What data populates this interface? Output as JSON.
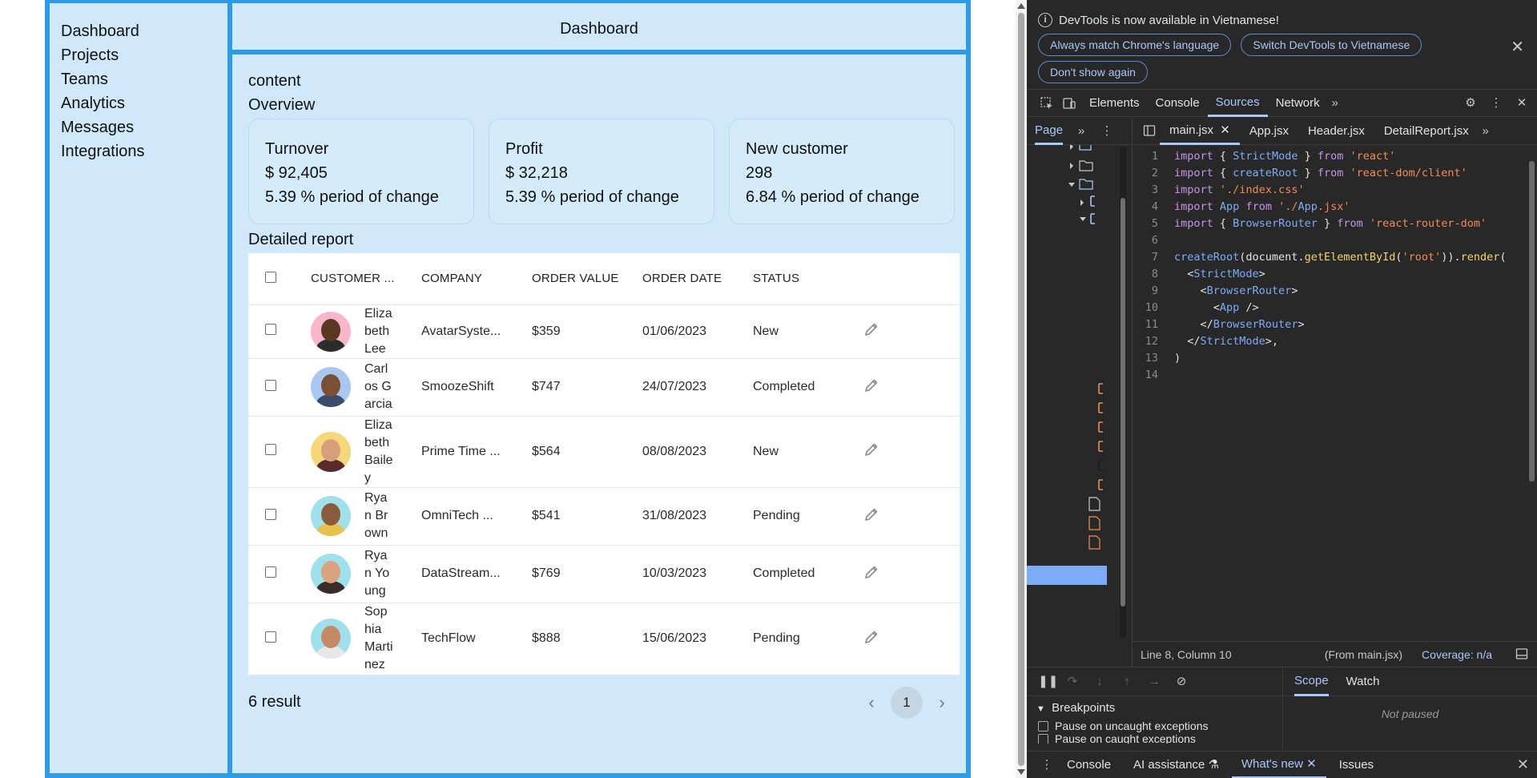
{
  "sidebar": {
    "items": [
      {
        "label": "Dashboard"
      },
      {
        "label": "Projects"
      },
      {
        "label": "Teams"
      },
      {
        "label": "Analytics"
      },
      {
        "label": "Messages"
      },
      {
        "label": "Integrations"
      }
    ]
  },
  "header": {
    "title": "Dashboard"
  },
  "main": {
    "content_label": "content",
    "overview_label": "Overview",
    "cards": [
      {
        "title": "Turnover",
        "value": "$ 92,405",
        "change": "5.39 % period of change"
      },
      {
        "title": "Profit",
        "value": "$ 32,218",
        "change": "5.39 % period of change"
      },
      {
        "title": "New customer",
        "value": "298",
        "change": "6.84 % period of change"
      }
    ],
    "report_title": "Detailed report",
    "table": {
      "headers": [
        "CUSTOMER ...",
        "COMPANY",
        "ORDER VALUE",
        "ORDER DATE",
        "STATUS"
      ],
      "rows": [
        {
          "name": "Elizabeth Lee",
          "company": "AvatarSyste...",
          "value": "$359",
          "date": "01/06/2023",
          "status": "New",
          "avatar_bg": "#f7b6c9",
          "skin": "#5a3825",
          "shirt": "#2c2c2c"
        },
        {
          "name": "Carlos Garcia",
          "company": "SmoozeShift",
          "value": "$747",
          "date": "24/07/2023",
          "status": "Completed",
          "avatar_bg": "#a9c7f0",
          "skin": "#7a4f33",
          "shirt": "#3a4a6a"
        },
        {
          "name": "Elizabeth Bailey",
          "company": "Prime Time ...",
          "value": "$564",
          "date": "08/08/2023",
          "status": "New",
          "avatar_bg": "#f6d77a",
          "skin": "#d6a07a",
          "shirt": "#5a2a2a"
        },
        {
          "name": "Ryan Brown",
          "company": "OmniTech ...",
          "value": "$541",
          "date": "31/08/2023",
          "status": "Pending",
          "avatar_bg": "#9fe0ea",
          "skin": "#8a5a3c",
          "shirt": "#e8c14a"
        },
        {
          "name": "Ryan Young",
          "company": "DataStream...",
          "value": "$769",
          "date": "10/03/2023",
          "status": "Completed",
          "avatar_bg": "#9fe0ea",
          "skin": "#d9a37f",
          "shirt": "#3a2a2a"
        },
        {
          "name": "Sophia Martinez",
          "company": "TechFlow",
          "value": "$888",
          "date": "15/06/2023",
          "status": "Pending",
          "avatar_bg": "#9fe0ea",
          "skin": "#c48a66",
          "shirt": "#e7e7e7"
        }
      ]
    },
    "result_count": "6 result",
    "pagination": {
      "current": "1"
    }
  },
  "devtools": {
    "notice": "DevTools is now available in Vietnamese!",
    "notice_buttons": [
      "Always match Chrome's language",
      "Switch DevTools to Vietnamese",
      "Don't show again"
    ],
    "tabs": [
      "Elements",
      "Console",
      "Sources",
      "Network"
    ],
    "active_tab": "Sources",
    "nav_tab": "Page",
    "file_tabs": [
      "main.jsx",
      "App.jsx",
      "Header.jsx",
      "DetailReport.jsx"
    ],
    "code_lines": [
      "import { StrictMode } from 'react'",
      "import { createRoot } from 'react-dom/client'",
      "import './index.css'",
      "import App from './App.jsx'",
      "import { BrowserRouter } from 'react-router-dom'",
      "",
      "createRoot(document.getElementById('root')).render(",
      "  <StrictMode>",
      "    <BrowserRouter>",
      "      <App />",
      "    </BrowserRouter>",
      "  </StrictMode>,",
      ")",
      ""
    ],
    "status": {
      "position": "Line 8, Column 10",
      "from": "(From main.jsx)",
      "coverage": "Coverage: n/a"
    },
    "breakpoints_label": "Breakpoints",
    "breakpoint_options": [
      "Pause on uncaught exceptions",
      "Pause on caught exceptions"
    ],
    "scope_tabs": [
      "Scope",
      "Watch"
    ],
    "not_paused": "Not paused",
    "drawer_tabs": [
      "Console",
      "AI assistance",
      "What's new",
      "Issues"
    ]
  }
}
